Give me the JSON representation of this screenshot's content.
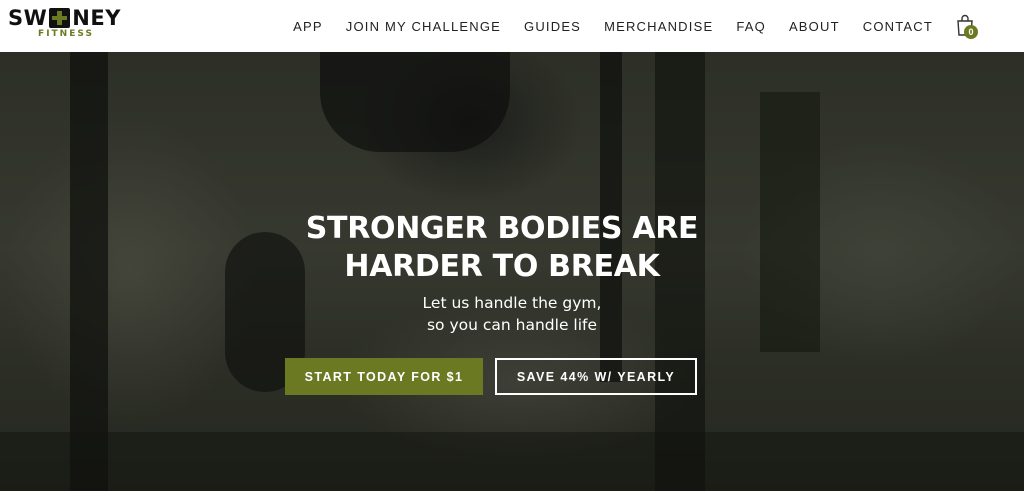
{
  "brand": {
    "name_left": "SW",
    "name_right": "NEY",
    "sub": "FITNESS",
    "accent_color": "#6b7a22"
  },
  "nav": {
    "items": [
      {
        "label": "APP"
      },
      {
        "label": "JOIN MY CHALLENGE"
      },
      {
        "label": "GUIDES"
      },
      {
        "label": "MERCHANDISE"
      },
      {
        "label": "FAQ"
      },
      {
        "label": "ABOUT"
      },
      {
        "label": "CONTACT"
      }
    ],
    "cart_icon": "shopping-bag-icon",
    "cart_count": "0"
  },
  "hero": {
    "title_line1": "STRONGER BODIES ARE",
    "title_line2": "HARDER TO BREAK",
    "subtitle_line1": "Let us handle the gym,",
    "subtitle_line2": "so you can handle life",
    "primary_button": "START TODAY FOR $1",
    "secondary_button": "SAVE 44% W/ YEARLY"
  }
}
